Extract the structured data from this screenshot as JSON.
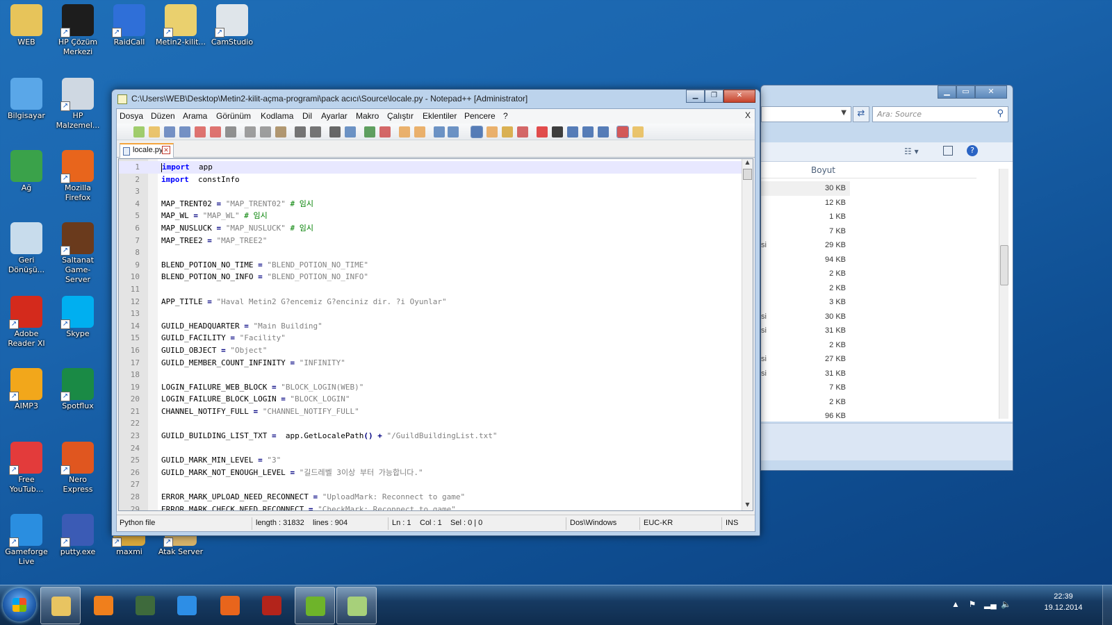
{
  "desktop": {
    "icons": [
      {
        "label": "WEB",
        "icon": "folder-user-icon",
        "color": "#e7c45a"
      },
      {
        "label": "HP Çözüm Merkezi",
        "icon": "hp-icon",
        "color": "#1d1d1d"
      },
      {
        "label": "RaidCall",
        "icon": "raidcall-icon",
        "color": "#2f6fd8"
      },
      {
        "label": "Metin2-kilit...",
        "icon": "folder-icon",
        "color": "#ead06e"
      },
      {
        "label": "CamStudio",
        "icon": "camstudio-icon",
        "color": "#dfe5ea"
      },
      {
        "label": "Bilgisayar",
        "icon": "computer-icon",
        "color": "#5aa7e8"
      },
      {
        "label": "HP Malzemel...",
        "icon": "printer-icon",
        "color": "#cfd8e2"
      },
      {
        "label": "Ağ",
        "icon": "network-globe-icon",
        "color": "#3aa24a"
      },
      {
        "label": "Mozilla Firefox",
        "icon": "firefox-icon",
        "color": "#e8651c"
      },
      {
        "label": "Geri Dönüşü...",
        "icon": "recycle-bin-icon",
        "color": "#c8dcec"
      },
      {
        "label": "Saltanat Game-Server",
        "icon": "saltanat-icon",
        "color": "#6a3a1c"
      },
      {
        "label": "Adobe Reader XI",
        "icon": "adobe-reader-icon",
        "color": "#d42a1c"
      },
      {
        "label": "Skype",
        "icon": "skype-icon",
        "color": "#00aff0"
      },
      {
        "label": "AIMP3",
        "icon": "aimp-icon",
        "color": "#f2a71b"
      },
      {
        "label": "Spotflux",
        "icon": "spotflux-icon",
        "color": "#1a8a45"
      },
      {
        "label": "Free YouTub...",
        "icon": "download-icon",
        "color": "#e33b3b"
      },
      {
        "label": "Nero Express",
        "icon": "nero-icon",
        "color": "#e0561f"
      },
      {
        "label": "Gameforge Live",
        "icon": "gameforge-icon",
        "color": "#2a8ee0"
      },
      {
        "label": "putty.exe",
        "icon": "putty-icon",
        "color": "#3b5bb5"
      },
      {
        "label": "maxmi",
        "icon": "maxmi-icon",
        "color": "#d9a83c"
      },
      {
        "label": "Atak Server",
        "icon": "atak-server-icon",
        "color": "#d8b46a"
      }
    ]
  },
  "explorer": {
    "search_placeholder": "Ara: Source",
    "column_size": "Boyut",
    "sizes": [
      "30 KB",
      "12 KB",
      "1 KB",
      "7 KB",
      "29 KB",
      "94 KB",
      "2 KB",
      "2 KB",
      "3 KB",
      "30 KB",
      "31 KB",
      "2 KB",
      "27 KB",
      "31 KB",
      "7 KB",
      "2 KB",
      "96 KB"
    ],
    "partial_names": [
      "",
      "",
      "",
      "",
      "si",
      "",
      "",
      "",
      "",
      "si",
      "si",
      "",
      "si",
      "si",
      "",
      "",
      ""
    ]
  },
  "npp": {
    "title": "C:\\Users\\WEB\\Desktop\\Metin2-kilit-açma-programi\\pack acıcı\\Source\\locale.py - Notepad++ [Administrator]",
    "menu": [
      "Dosya",
      "Düzen",
      "Arama",
      "Görünüm",
      "Kodlama",
      "Dil",
      "Ayarlar",
      "Makro",
      "Çalıştır",
      "Eklentiler",
      "Pencere",
      "?"
    ],
    "menu_close": "X",
    "tab_label": "locale.py",
    "status": {
      "filetype": "Python file",
      "length": "length : 31832",
      "lines": "lines : 904",
      "ln": "Ln : 1",
      "col": "Col : 1",
      "sel": "Sel : 0 | 0",
      "eol": "Dos\\Windows",
      "encoding": "EUC-KR",
      "mode": "INS"
    },
    "code": [
      {
        "n": "1",
        "t": [
          [
            "kw",
            "import"
          ],
          [
            "",
            "  app"
          ]
        ]
      },
      {
        "n": "2",
        "t": [
          [
            "kw",
            "import"
          ],
          [
            "",
            "  constInfo"
          ]
        ]
      },
      {
        "n": "3",
        "t": []
      },
      {
        "n": "4",
        "t": [
          [
            "",
            "MAP_TRENT02 "
          ],
          [
            "op",
            "="
          ],
          [
            "str",
            " \"MAP_TRENT02\""
          ],
          [
            "cm",
            " # 임시"
          ]
        ]
      },
      {
        "n": "5",
        "t": [
          [
            "",
            "MAP_WL "
          ],
          [
            "op",
            "="
          ],
          [
            "str",
            " \"MAP_WL\""
          ],
          [
            "cm",
            " # 임시"
          ]
        ]
      },
      {
        "n": "6",
        "t": [
          [
            "",
            "MAP_NUSLUCK "
          ],
          [
            "op",
            "="
          ],
          [
            "str",
            " \"MAP_NUSLUCK\""
          ],
          [
            "cm",
            " # 임시"
          ]
        ]
      },
      {
        "n": "7",
        "t": [
          [
            "",
            "MAP_TREE2 "
          ],
          [
            "op",
            "="
          ],
          [
            "str",
            " \"MAP_TREE2\""
          ]
        ]
      },
      {
        "n": "8",
        "t": []
      },
      {
        "n": "9",
        "t": [
          [
            "",
            "BLEND_POTION_NO_TIME "
          ],
          [
            "op",
            "="
          ],
          [
            "str",
            " \"BLEND_POTION_NO_TIME\""
          ]
        ]
      },
      {
        "n": "10",
        "t": [
          [
            "",
            "BLEND_POTION_NO_INFO "
          ],
          [
            "op",
            "="
          ],
          [
            "str",
            " \"BLEND_POTION_NO_INFO\""
          ]
        ]
      },
      {
        "n": "11",
        "t": []
      },
      {
        "n": "12",
        "t": [
          [
            "",
            "APP_TITLE "
          ],
          [
            "op",
            "="
          ],
          [
            "str",
            " \"Haval Metin2 G?encemiz G?enciniz dir. ?i Oyunlar\""
          ]
        ]
      },
      {
        "n": "13",
        "t": []
      },
      {
        "n": "14",
        "t": [
          [
            "",
            "GUILD_HEADQUARTER "
          ],
          [
            "op",
            "="
          ],
          [
            "str",
            " \"Main Building\""
          ]
        ]
      },
      {
        "n": "15",
        "t": [
          [
            "",
            "GUILD_FACILITY "
          ],
          [
            "op",
            "="
          ],
          [
            "str",
            " \"Facility\""
          ]
        ]
      },
      {
        "n": "16",
        "t": [
          [
            "",
            "GUILD_OBJECT "
          ],
          [
            "op",
            "="
          ],
          [
            "str",
            " \"Object\""
          ]
        ]
      },
      {
        "n": "17",
        "t": [
          [
            "",
            "GUILD_MEMBER_COUNT_INFINITY "
          ],
          [
            "op",
            "="
          ],
          [
            "str",
            " \"INFINITY\""
          ]
        ]
      },
      {
        "n": "18",
        "t": []
      },
      {
        "n": "19",
        "t": [
          [
            "",
            "LOGIN_FAILURE_WEB_BLOCK "
          ],
          [
            "op",
            "="
          ],
          [
            "str",
            " \"BLOCK_LOGIN(WEB)\""
          ]
        ]
      },
      {
        "n": "20",
        "t": [
          [
            "",
            "LOGIN_FAILURE_BLOCK_LOGIN "
          ],
          [
            "op",
            "="
          ],
          [
            "str",
            " \"BLOCK_LOGIN\""
          ]
        ]
      },
      {
        "n": "21",
        "t": [
          [
            "",
            "CHANNEL_NOTIFY_FULL "
          ],
          [
            "op",
            "="
          ],
          [
            "str",
            " \"CHANNEL_NOTIFY_FULL\""
          ]
        ]
      },
      {
        "n": "22",
        "t": []
      },
      {
        "n": "23",
        "t": [
          [
            "",
            "GUILD_BUILDING_LIST_TXT "
          ],
          [
            "op",
            "="
          ],
          [
            "",
            "  app.GetLocalePath"
          ],
          [
            "op",
            "()"
          ],
          [
            "op",
            " +"
          ],
          [
            "str",
            " \"/GuildBuildingList.txt\""
          ]
        ]
      },
      {
        "n": "24",
        "t": []
      },
      {
        "n": "25",
        "t": [
          [
            "",
            "GUILD_MARK_MIN_LEVEL "
          ],
          [
            "op",
            "="
          ],
          [
            "str",
            " \"3\""
          ]
        ]
      },
      {
        "n": "26",
        "t": [
          [
            "",
            "GUILD_MARK_NOT_ENOUGH_LEVEL "
          ],
          [
            "op",
            "="
          ],
          [
            "str",
            " \"길드레벨 3이상 부터 가능합니다.\""
          ]
        ]
      },
      {
        "n": "27",
        "t": []
      },
      {
        "n": "28",
        "t": [
          [
            "",
            "ERROR_MARK_UPLOAD_NEED_RECONNECT "
          ],
          [
            "op",
            "="
          ],
          [
            "str",
            " \"UploadMark: Reconnect to game\""
          ]
        ]
      },
      {
        "n": "29",
        "t": [
          [
            "",
            "ERROR_MARK_CHECK_NEED_RECONNECT "
          ],
          [
            "op",
            "="
          ],
          [
            "str",
            " \"CheckMark: Reconnect to game\""
          ]
        ]
      }
    ]
  },
  "taskbar": {
    "clock_time": "22:39",
    "clock_date": "19.12.2014",
    "apps": [
      {
        "icon": "explorer-folder-icon",
        "color": "#e8c461"
      },
      {
        "icon": "media-player-icon",
        "color": "#f07f1c"
      },
      {
        "icon": "network-monitor-icon",
        "color": "#3e6a3c"
      },
      {
        "icon": "internet-explorer-icon",
        "color": "#2d8ee6"
      },
      {
        "icon": "firefox-icon",
        "color": "#e8651c"
      },
      {
        "icon": "metin2-icon",
        "color": "#b3241b"
      },
      {
        "icon": "nvidia-icon",
        "color": "#6eb42a"
      },
      {
        "icon": "notepadpp-icon",
        "color": "#a7d07a"
      }
    ]
  }
}
